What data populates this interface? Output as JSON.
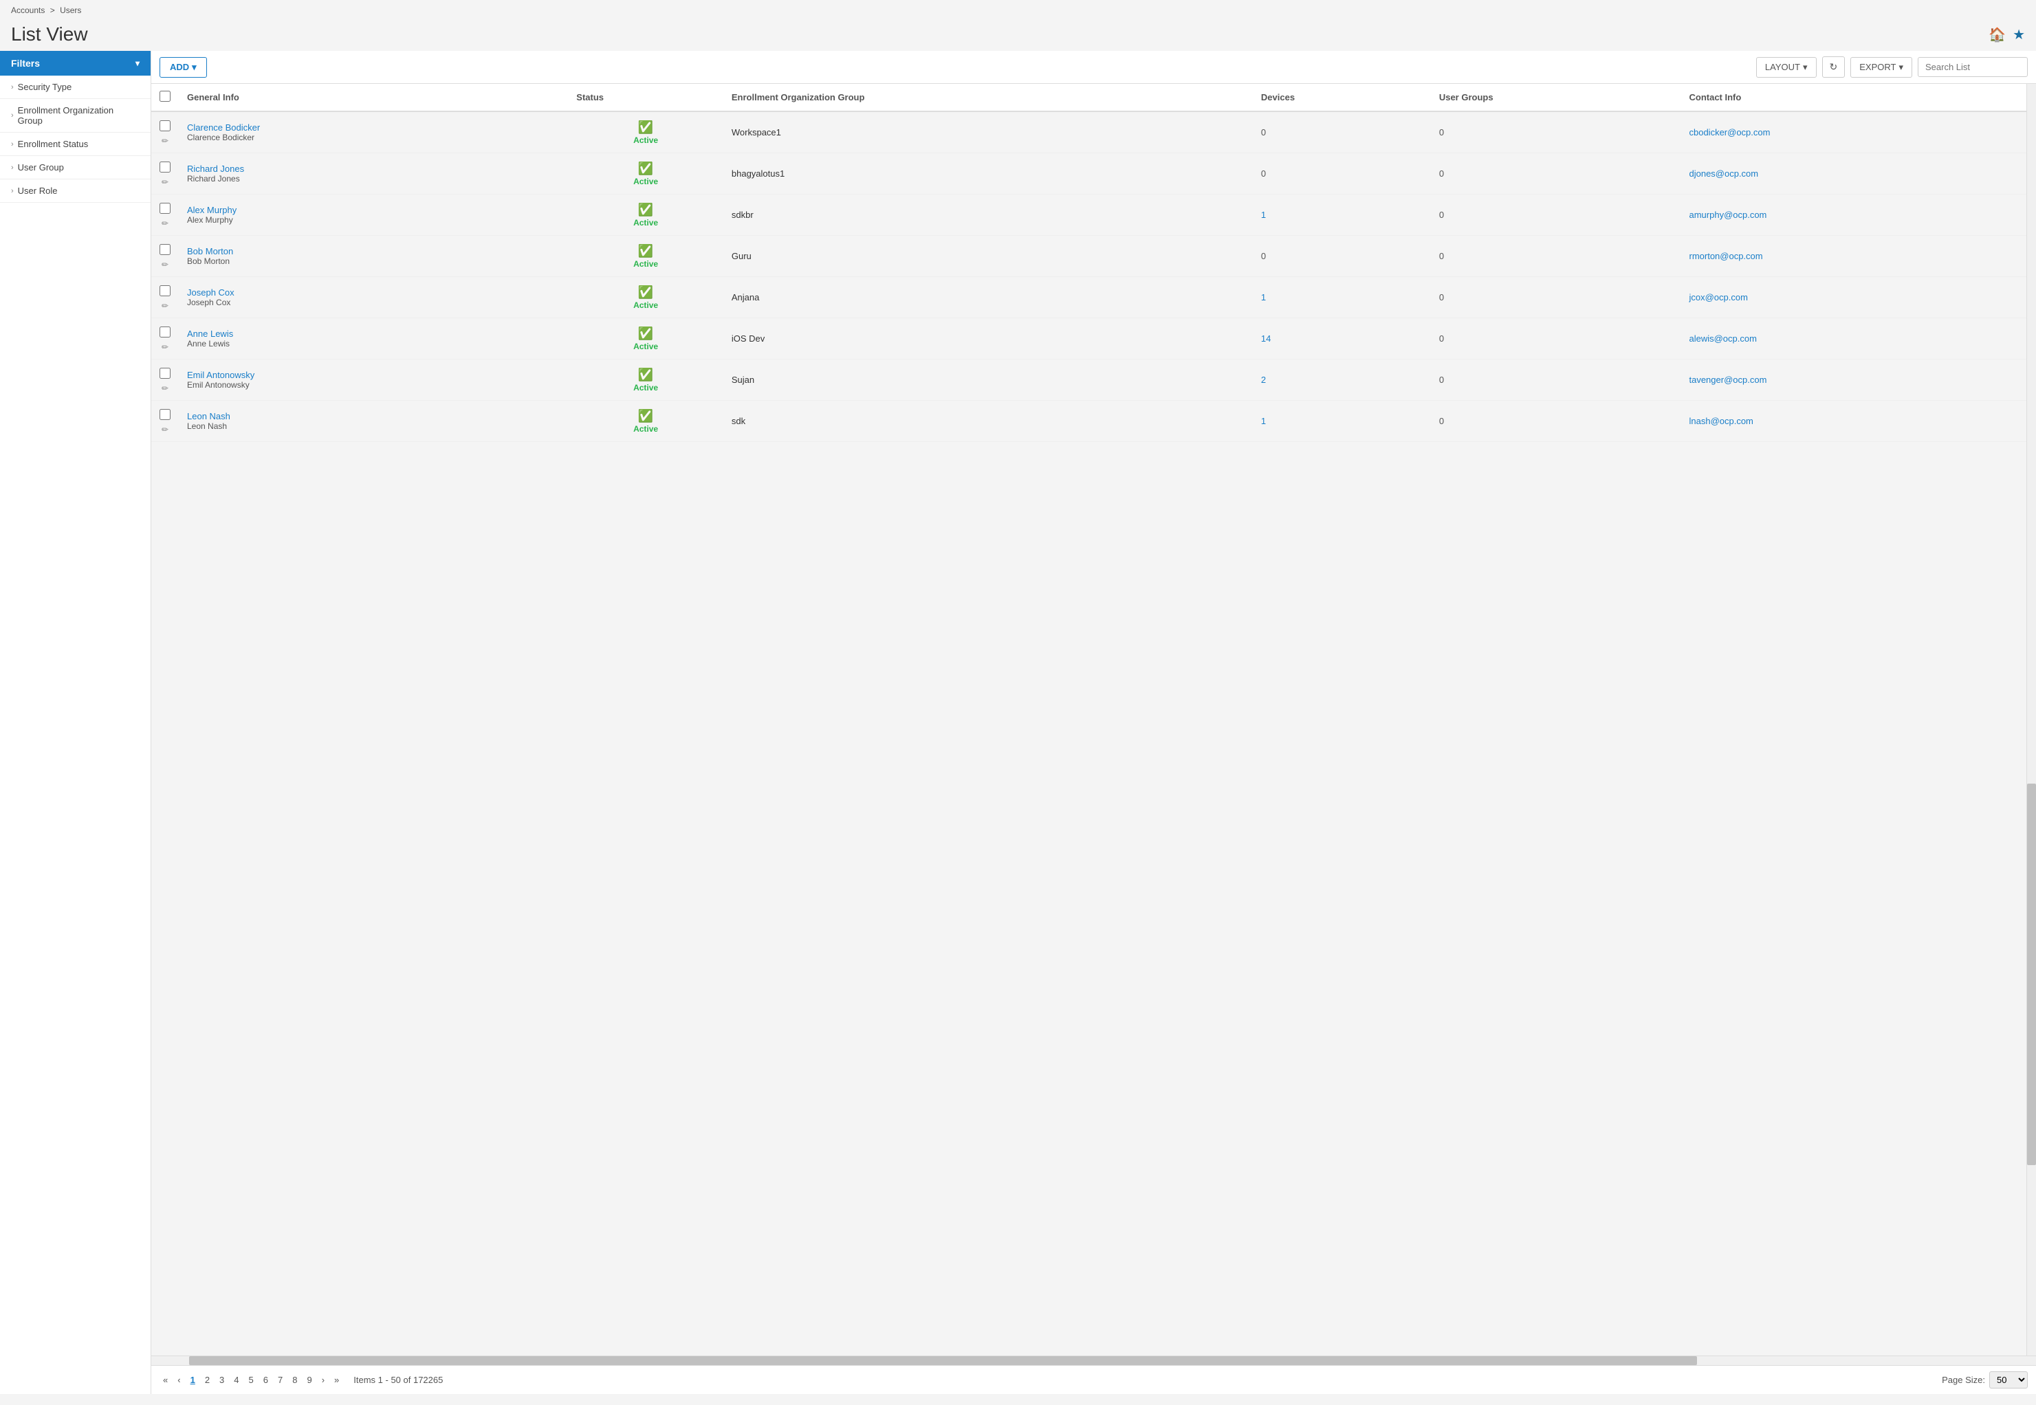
{
  "breadcrumb": {
    "accounts": "Accounts",
    "separator": ">",
    "users": "Users"
  },
  "page": {
    "title": "List View",
    "home_icon": "🏠",
    "star_icon": "★"
  },
  "toolbar": {
    "add_label": "ADD",
    "layout_label": "LAYOUT",
    "refresh_icon": "↻",
    "export_label": "EXPORT",
    "search_placeholder": "Search List"
  },
  "filters": {
    "header": "Filters",
    "items": [
      {
        "label": "Security Type"
      },
      {
        "label": "Enrollment Organization Group"
      },
      {
        "label": "Enrollment Status"
      },
      {
        "label": "User Group"
      },
      {
        "label": "User Role"
      }
    ]
  },
  "table": {
    "columns": [
      {
        "key": "general_info",
        "label": "General Info"
      },
      {
        "key": "status",
        "label": "Status"
      },
      {
        "key": "enrollment_org_group",
        "label": "Enrollment Organization Group"
      },
      {
        "key": "devices",
        "label": "Devices"
      },
      {
        "key": "user_groups",
        "label": "User Groups"
      },
      {
        "key": "contact_info",
        "label": "Contact Info"
      }
    ],
    "rows": [
      {
        "name_link": "Clarence Bodicker",
        "name_plain": "Clarence Bodicker",
        "status": "Active",
        "enrollment_org": "Workspace1",
        "devices": "0",
        "devices_blue": false,
        "user_groups": "0",
        "email": "cbodicker@ocp.com"
      },
      {
        "name_link": "Richard Jones",
        "name_plain": "Richard Jones",
        "status": "Active",
        "enrollment_org": "bhagyalotus1",
        "devices": "0",
        "devices_blue": false,
        "user_groups": "0",
        "email": "djones@ocp.com"
      },
      {
        "name_link": "Alex Murphy",
        "name_plain": "Alex Murphy",
        "status": "Active",
        "enrollment_org": "sdkbr",
        "devices": "1",
        "devices_blue": true,
        "user_groups": "0",
        "email": "amurphy@ocp.com"
      },
      {
        "name_link": "Bob Morton",
        "name_plain": "Bob Morton",
        "status": "Active",
        "enrollment_org": "Guru",
        "devices": "0",
        "devices_blue": false,
        "user_groups": "0",
        "email": "rmorton@ocp.com"
      },
      {
        "name_link": "Joseph Cox",
        "name_plain": "Joseph Cox",
        "status": "Active",
        "enrollment_org": "Anjana",
        "devices": "1",
        "devices_blue": true,
        "user_groups": "0",
        "email": "jcox@ocp.com"
      },
      {
        "name_link": "Anne Lewis",
        "name_plain": "Anne Lewis",
        "status": "Active",
        "enrollment_org": "iOS Dev",
        "devices": "14",
        "devices_blue": true,
        "user_groups": "0",
        "email": "alewis@ocp.com"
      },
      {
        "name_link": "Emil Antonowsky",
        "name_plain": "Emil Antonowsky",
        "status": "Active",
        "enrollment_org": "Sujan",
        "devices": "2",
        "devices_blue": true,
        "user_groups": "0",
        "email": "tavenger@ocp.com"
      },
      {
        "name_link": "Leon Nash",
        "name_plain": "Leon Nash",
        "status": "Active",
        "enrollment_org": "sdk",
        "devices": "1",
        "devices_blue": true,
        "user_groups": "0",
        "email": "lnash@ocp.com"
      }
    ]
  },
  "pagination": {
    "first_icon": "«",
    "prev_icon": "‹",
    "pages": [
      "1",
      "2",
      "3",
      "4",
      "5",
      "6",
      "7",
      "8",
      "9"
    ],
    "active_page": "1",
    "next_icon": "›",
    "last_icon": "»",
    "items_info": "Items 1 - 50 of 172265",
    "page_size_label": "Page Size:",
    "page_size_value": "50"
  }
}
